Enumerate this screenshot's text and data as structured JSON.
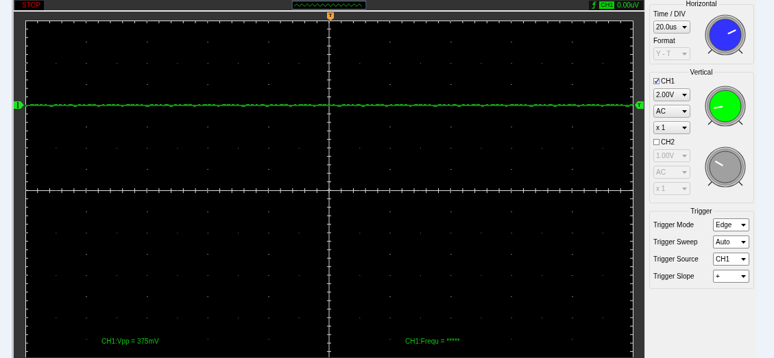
{
  "status_bar": {
    "run_state": "STOP",
    "trigger_channel": "CH1",
    "trigger_level": "0.00uV"
  },
  "scope": {
    "trigger_position_marker": "T",
    "trigger_level_marker": "T",
    "measurements": [
      {
        "text": "CH1:Vpp = 375mV"
      },
      {
        "text": "CH1:Frequ = *****"
      }
    ]
  },
  "panel": {
    "horizontal": {
      "title": "Horizontal",
      "fields": [
        {
          "label": "Time / DIV",
          "value": "20.0us",
          "disabled": false
        },
        {
          "label": "Format",
          "value": "Y - T",
          "disabled": true
        }
      ]
    },
    "vertical": {
      "title": "Vertical",
      "channels": [
        {
          "name": "CH1",
          "checked": true,
          "color": "#00ff00",
          "settings": [
            "2.00V",
            "AC",
            "x 1"
          ]
        },
        {
          "name": "CH2",
          "checked": false,
          "color": "#a0a0a0",
          "settings": [
            "1.00V",
            "AC",
            "x 1"
          ]
        }
      ]
    },
    "trigger": {
      "title": "Trigger",
      "rows": [
        {
          "label": "Trigger Mode",
          "value": "Edge"
        },
        {
          "label": "Trigger Sweep",
          "value": "Auto"
        },
        {
          "label": "Trigger Source",
          "value": "CH1"
        },
        {
          "label": "Trigger Slope",
          "value": "+"
        }
      ]
    }
  }
}
